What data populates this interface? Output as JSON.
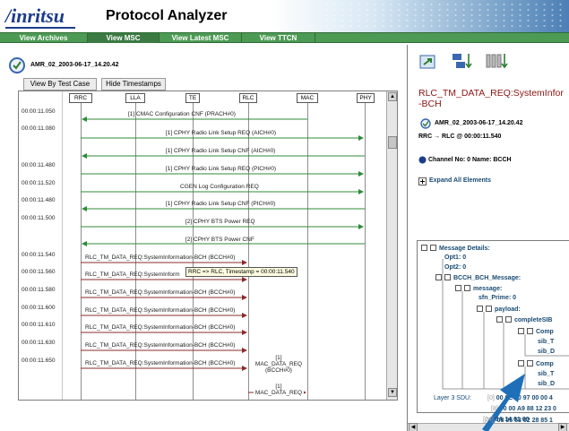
{
  "header": {
    "logo": "/inritsu",
    "title": "Protocol Analyzer"
  },
  "nav": {
    "items": [
      "View Archives",
      "View MSC",
      "View Latest MSC",
      "View TTCN"
    ]
  },
  "file": {
    "name": "AMR_02_2003-06-17_14.20.42"
  },
  "buttons": {
    "view_by_test_case": "View By Test Case",
    "hide_timestamps": "Hide Timestamps"
  },
  "msc": {
    "entities": [
      "RRC",
      "LLA",
      "TE",
      "RLC",
      "MAC",
      "PHY"
    ],
    "timestamps": [
      "00:00:11.050",
      "00:00:11.080",
      "00:00:11.480",
      "00:00:11.520",
      "00:00:11.480",
      "00:00:11.500",
      "00:00:11.540",
      "00:00:11.560",
      "00:00:11.580",
      "00:00:11.600",
      "00:00:11.610",
      "00:00:11.630",
      "00:00:11.650"
    ],
    "messages": [
      "[1] CMAC Configuration CNF (PRACH#0)",
      "[1] CPHY Radio Link Setup REQ (AICH#0)",
      "[1] CPHY Radio Link Setup CNF (AICH#0)",
      "[1] CPHY Radio Link Setup REQ (PICH#0)",
      "CGEN Log Configuration REQ",
      "[1] CPHY Radio Link Setup CNF (PICH#0)",
      "[2] CPHY BTS Power REQ",
      "[2] CPHY BTS Power CNF",
      "RLC_TM_DATA_REQ:SystemInformation-BCH (BCCH#0)",
      "RLC_TM_DATA_REQ:SystemInform",
      "RLC_TM_DATA_REQ:SystemInformation-BCH (BCCH#0)",
      "RLC_TM_DATA_REQ:SystemInformation-BCH (BCCH#0)",
      "RLC_TM_DATA_REQ:SystemInformation-BCH (BCCH#0)",
      "RLC_TM_DATA_REQ:SystemInformation-BCH (BCCH#0)",
      "RLC_TM_DATA_REQ:SystemInformation-BCH (BCCH#0)"
    ],
    "tooltip": "RRC => RLC, Timestamp = 00:00:11.540",
    "mac_msgs": [
      [
        "[1]",
        "MAC_DATA_REQ",
        "(BCCH#0)"
      ],
      [
        "[1]",
        "MAC_DATA_REQ"
      ]
    ]
  },
  "detail": {
    "title_lines": [
      "RLC_TM_DATA_REQ:SystemInfor",
      "-BCH"
    ],
    "file": "AMR_02_2003-06-17_14.20.42",
    "route": "RRC → RLC @ 00:00:11.540",
    "channel": "Channel No:  0 Name: BCCH",
    "expand_all": "Expand All Elements",
    "tree": {
      "message_details": "Message Details:",
      "opt1": "Opt1: 0",
      "opt2": "Opt2: 0",
      "bcch_bch": "BCCH_BCH_Message:",
      "message": "message:",
      "sfn_prime": "sfn_Prime: 0",
      "payload": "payload:",
      "complete": "completeSIB",
      "comp1": "Comp",
      "sib1a": "sib_T",
      "sib1b": "sib_D",
      "comp2": "Comp",
      "sib2a": "sib_T",
      "sib2b": "sib_D"
    },
    "layer3_label": "Layer 3 SDU:",
    "sdu_rows": [
      {
        "idx": "[0]",
        "bytes": "00 0E 20 97 00 00 4"
      },
      {
        "idx": "[8]",
        "bytes": "00 00 A9 88 12 23 0"
      },
      {
        "idx": "[16]",
        "bytes": "08 95 53 02 28 85 1"
      },
      {
        "idx": "[24]",
        "bytes": "9A 14 01 00"
      }
    ]
  },
  "colors": {
    "nav_green": "#4d9a54",
    "title_red": "#8a1411",
    "arrow_green": "#2e8b3a",
    "tooltip_bg": "#fffde0"
  }
}
